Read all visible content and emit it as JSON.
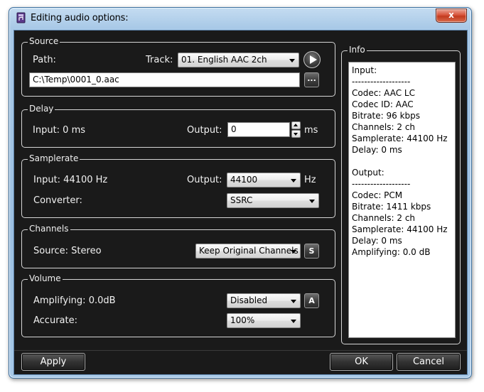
{
  "window": {
    "title": "Editing audio options:",
    "close_glyph": "x"
  },
  "source": {
    "legend": "Source",
    "path_label": "Path:",
    "track_label": "Track:",
    "track_value": "01. English AAC 2ch",
    "path_value": "C:\\Temp\\0001_0.aac",
    "browse_label": "..."
  },
  "delay": {
    "legend": "Delay",
    "input_label": "Input: 0 ms",
    "output_label": "Output:",
    "output_value": "0",
    "unit": "ms"
  },
  "samplerate": {
    "legend": "Samplerate",
    "input_label": "Input: 44100 Hz",
    "output_label": "Output:",
    "output_value": "44100",
    "unit": "Hz",
    "converter_label": "Converter:",
    "converter_value": "SSRC"
  },
  "channels": {
    "legend": "Channels",
    "source_label": "Source: Stereo",
    "mode_value": "Keep Original Channels",
    "button_label": "S"
  },
  "volume": {
    "legend": "Volume",
    "amplifying_label": "Amplifying: 0.0dB",
    "amplifying_value": "Disabled",
    "button_label": "A",
    "accurate_label": "Accurate:",
    "accurate_value": "100%"
  },
  "info": {
    "legend": "Info",
    "lines": [
      "Input:",
      "-------------------",
      "Codec: AAC LC",
      "Codec ID: AAC",
      "Bitrate: 96 kbps",
      "Channels: 2 ch",
      "Samplerate: 44100 Hz",
      "Delay: 0 ms",
      "",
      "Output:",
      "-------------------",
      "Codec: PCM",
      "Bitrate: 1411 kbps",
      "Channels: 2 ch",
      "Samplerate: 44100 Hz",
      "Delay: 0 ms",
      "Amplifying: 0.0 dB"
    ]
  },
  "buttons": {
    "apply": "Apply",
    "ok": "OK",
    "cancel": "Cancel"
  },
  "colors": {
    "client_bg": "#1a1a1a",
    "group_border": "#d6d6d6",
    "title_bar": "#a9c9e7",
    "close": "#c23a1f"
  },
  "icons": {
    "app": "audio-document-icon",
    "play": "play-icon",
    "close": "close-icon"
  }
}
